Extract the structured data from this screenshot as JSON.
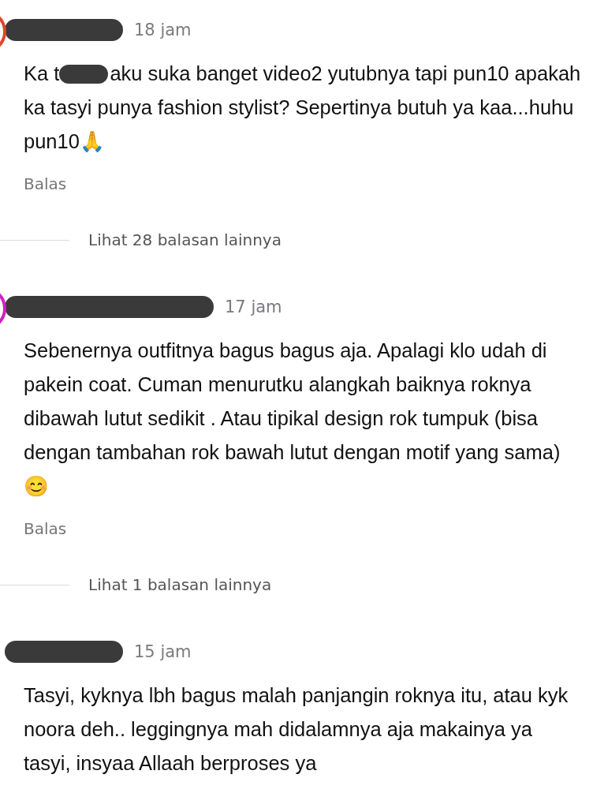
{
  "comments": [
    {
      "time": "18 jam",
      "color": "#e0452a",
      "body_before_redaction": "Ka t",
      "body": "aku suka banget video2 yutubnya tapi pun10 apakah ka tasyi punya fashion stylist? Sepertinya butuh ya kaa...huhu pun10🙏",
      "reply": "Balas",
      "more_replies": "Lihat 28 balasan lainnya"
    },
    {
      "time": "17 jam",
      "color": "#d21fc4",
      "body": "Sebenernya outfitnya bagus bagus aja. Apalagi klo udah di pakein coat. Cuman menurutku alangkah baiknya roknya dibawah lutut sedikit . Atau tipikal design rok tumpuk (bisa dengan tambahan rok bawah lutut dengan motif yang sama) 😊",
      "reply": "Balas",
      "more_replies": "Lihat 1 balasan lainnya"
    },
    {
      "time": "15 jam",
      "body": "Tasyi, kyknya lbh bagus malah panjangin roknya itu, atau kyk noora deh.. leggingnya mah didalamnya aja makainya ya tasyi, insyaa Allaah berproses ya"
    }
  ]
}
